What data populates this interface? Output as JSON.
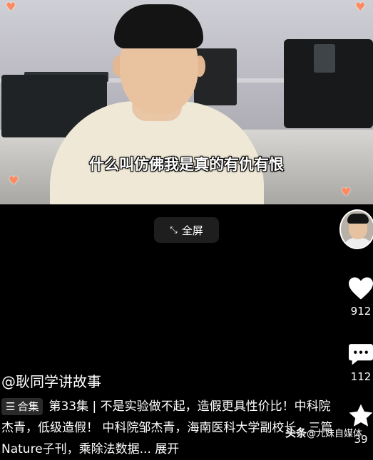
{
  "video": {
    "subtitle": "什么叫仿佛我是真的有仇有恨"
  },
  "fullscreen": {
    "label": "全屏"
  },
  "actions": {
    "like_count": "912",
    "comment_count": "112",
    "favorite_count": "39"
  },
  "post": {
    "author": "@耿同学讲故事",
    "collection_label": "合集",
    "description": "第33集 | 不是实验做不起，造假更具性价比！中科院杰青，低级造假！ 中科院邹杰青，海南医科大学副校长，三篇Nature子刊，乘除法数据... 展开"
  },
  "watermark": {
    "brand": "头条",
    "account": "@九妹自媒体"
  },
  "icons": {
    "heart": "heart-icon",
    "comment": "comment-icon",
    "star": "star-icon",
    "expand": "expand-arrows-icon",
    "collection": "stack-icon"
  }
}
